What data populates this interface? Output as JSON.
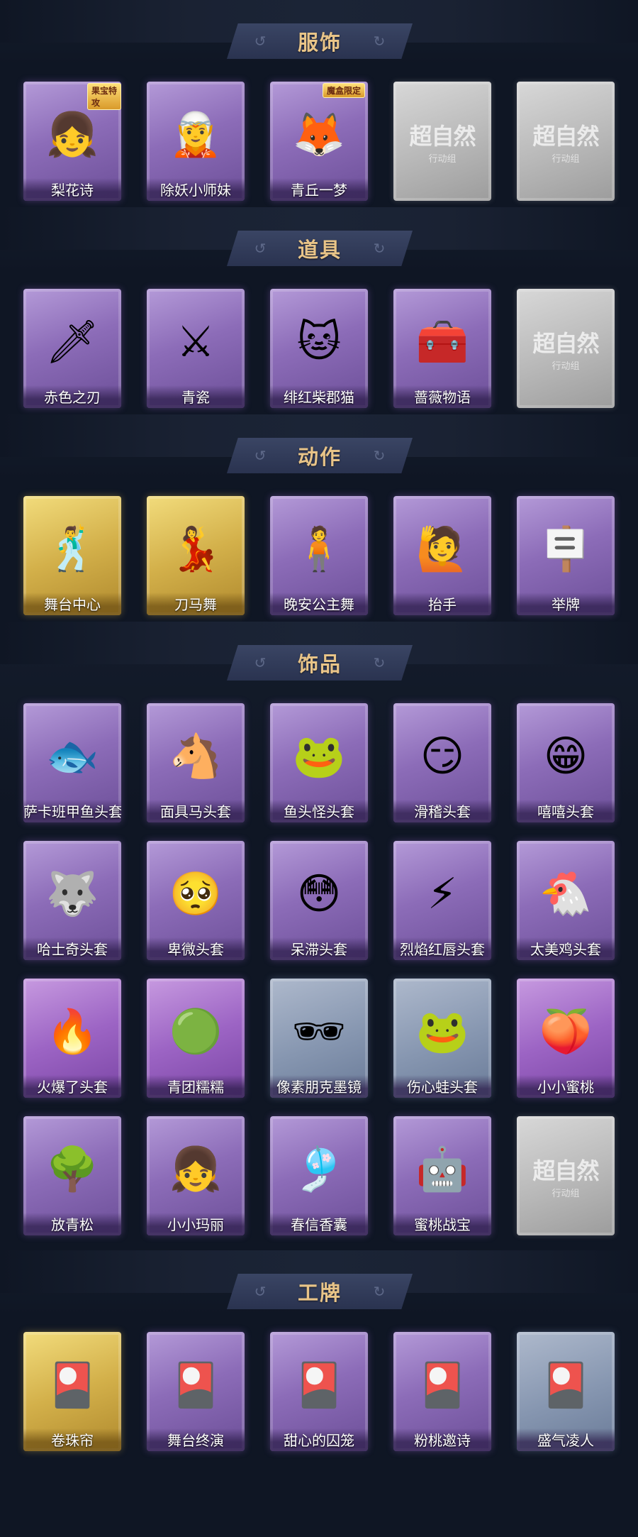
{
  "sections": [
    {
      "title": "服饰",
      "items": [
        {
          "label": "梨花诗",
          "bg": "purple",
          "icon": "character-girl-icon",
          "glyph": "👧",
          "badge": "果宝特攻"
        },
        {
          "label": "除妖小师妹",
          "bg": "purple",
          "icon": "character-girl-icon",
          "glyph": "🧝"
        },
        {
          "label": "青丘一梦",
          "bg": "purple",
          "icon": "character-girl-icon",
          "glyph": "🦊",
          "badge": "魔盒限定"
        },
        {
          "label": "",
          "bg": "gray",
          "icon": "placeholder-logo-icon",
          "placeholder": "超自然",
          "sub": "行动组"
        },
        {
          "label": "",
          "bg": "gray",
          "icon": "placeholder-logo-icon",
          "placeholder": "超自然",
          "sub": "行动组"
        }
      ]
    },
    {
      "title": "道具",
      "items": [
        {
          "label": "赤色之刃",
          "bg": "purple",
          "icon": "red-blade-icon",
          "glyph": "🗡"
        },
        {
          "label": "青瓷",
          "bg": "purple",
          "icon": "blue-sword-icon",
          "glyph": "⚔"
        },
        {
          "label": "绯红柴郡猫",
          "bg": "purple",
          "icon": "red-cat-icon",
          "glyph": "🐱"
        },
        {
          "label": "蔷薇物语",
          "bg": "purple",
          "icon": "medkit-icon",
          "glyph": "🧰"
        },
        {
          "label": "",
          "bg": "gray",
          "icon": "placeholder-logo-icon",
          "placeholder": "超自然",
          "sub": "行动组"
        }
      ]
    },
    {
      "title": "动作",
      "items": [
        {
          "label": "舞台中心",
          "bg": "gold",
          "icon": "dance-pose-icon",
          "glyph": "🕺"
        },
        {
          "label": "刀马舞",
          "bg": "gold",
          "icon": "dance-pose-icon",
          "glyph": "💃"
        },
        {
          "label": "晚安公主舞",
          "bg": "purple",
          "icon": "dance-pose-icon",
          "glyph": "🧍"
        },
        {
          "label": "抬手",
          "bg": "purple",
          "icon": "raise-hand-icon",
          "glyph": "🙋"
        },
        {
          "label": "举牌",
          "bg": "purple",
          "icon": "hold-sign-icon",
          "glyph": "🪧"
        }
      ]
    },
    {
      "title": "饰品",
      "items": [
        {
          "label": "萨卡班甲鱼头套",
          "bg": "purple",
          "icon": "fish-head-icon",
          "glyph": "🐟"
        },
        {
          "label": "面具马头套",
          "bg": "purple",
          "icon": "horse-head-icon",
          "glyph": "🐴"
        },
        {
          "label": "鱼头怪头套",
          "bg": "purple",
          "icon": "fish-monster-icon",
          "glyph": "🐸"
        },
        {
          "label": "滑稽头套",
          "bg": "purple",
          "icon": "smirk-face-icon",
          "glyph": "😏"
        },
        {
          "label": "嘻嘻头套",
          "bg": "purple",
          "icon": "grin-face-icon",
          "glyph": "😁"
        },
        {
          "label": "哈士奇头套",
          "bg": "purple",
          "icon": "husky-head-icon",
          "glyph": "🐺"
        },
        {
          "label": "卑微头套",
          "bg": "purple",
          "icon": "humble-face-icon",
          "glyph": "🥺"
        },
        {
          "label": "呆滞头套",
          "bg": "purple",
          "icon": "stunned-face-icon",
          "glyph": "😳"
        },
        {
          "label": "烈焰红唇头套",
          "bg": "purple",
          "icon": "pikachu-head-icon",
          "glyph": "⚡"
        },
        {
          "label": "太美鸡头套",
          "bg": "purple",
          "icon": "chicken-head-icon",
          "glyph": "🐔"
        },
        {
          "label": "火爆了头套",
          "bg": "violet",
          "icon": "fire-face-icon",
          "glyph": "🔥"
        },
        {
          "label": "青团糯糯",
          "bg": "violet",
          "icon": "green-dumpling-icon",
          "glyph": "🟢"
        },
        {
          "label": "像素朋克墨镜",
          "bg": "blue",
          "icon": "pixel-glasses-icon",
          "glyph": "🕶"
        },
        {
          "label": "伤心蛙头套",
          "bg": "blue",
          "icon": "sad-frog-icon",
          "glyph": "🐸"
        },
        {
          "label": "小小蜜桃",
          "bg": "violet",
          "icon": "peach-doll-icon",
          "glyph": "🍑"
        },
        {
          "label": "放青松",
          "bg": "purple",
          "icon": "bonsai-icon",
          "glyph": "🌳"
        },
        {
          "label": "小小玛丽",
          "bg": "purple",
          "icon": "doll-girl-icon",
          "glyph": "👧"
        },
        {
          "label": "春信香囊",
          "bg": "purple",
          "icon": "sachet-icon",
          "glyph": "🎐"
        },
        {
          "label": "蜜桃战宝",
          "bg": "purple",
          "icon": "peach-bot-icon",
          "glyph": "🤖"
        },
        {
          "label": "",
          "bg": "gray",
          "icon": "placeholder-logo-icon",
          "placeholder": "超自然",
          "sub": "行动组"
        }
      ]
    },
    {
      "title": "工牌",
      "items": [
        {
          "label": "卷珠帘",
          "bg": "gold",
          "icon": "badge-card-icon",
          "glyph": "🎴"
        },
        {
          "label": "舞台终演",
          "bg": "purple",
          "icon": "badge-card-icon",
          "glyph": "🎴"
        },
        {
          "label": "甜心的囚笼",
          "bg": "purple",
          "icon": "badge-card-icon",
          "glyph": "🎴"
        },
        {
          "label": "粉桃邀诗",
          "bg": "purple",
          "icon": "badge-card-icon",
          "glyph": "🎴"
        },
        {
          "label": "盛气凌人",
          "bg": "blue",
          "icon": "badge-card-icon",
          "glyph": "🎴"
        }
      ]
    }
  ],
  "colors": {
    "background": "#0f1624",
    "banner": "#2f3958",
    "title": "#e8c488"
  }
}
